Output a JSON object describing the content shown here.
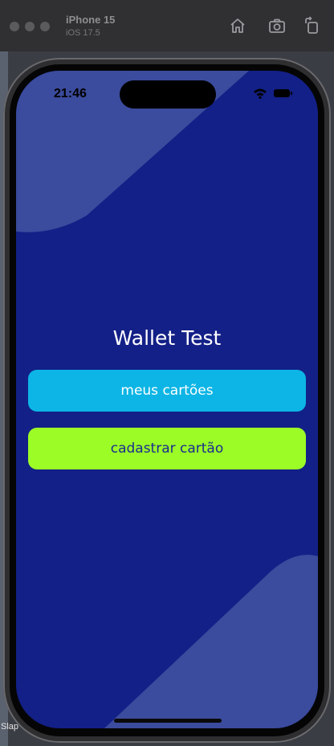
{
  "simulator": {
    "device_name": "iPhone 15",
    "os_version": "iOS 17.5"
  },
  "status_bar": {
    "time": "21:46",
    "signal": "...."
  },
  "app": {
    "title": "Wallet Test",
    "buttons": {
      "my_cards": "meus cartões",
      "register_card": "cadastrar cartão"
    }
  },
  "background_label": "Slap",
  "colors": {
    "screen_background": "#132087",
    "decor_shape": "#3b4b9d",
    "primary_button": "#0cb5e5",
    "secondary_button": "#9bfc26",
    "secondary_button_text": "#1b2c8f"
  }
}
